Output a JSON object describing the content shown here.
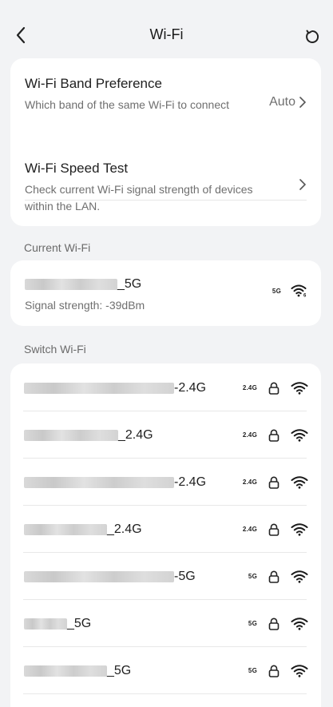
{
  "header": {
    "title": "Wi-Fi"
  },
  "band_preference": {
    "title": "Wi-Fi Band Preference",
    "description": "Which band of the same Wi-Fi to connect",
    "value": "Auto"
  },
  "speed_test": {
    "title": "Wi-Fi Speed Test",
    "description": "Check current Wi-Fi signal strength of devices within the LAN."
  },
  "current_wifi": {
    "section_label": "Current Wi-Fi",
    "name_suffix": "_5G",
    "signal": "Signal strength: -39dBm",
    "band": "5G"
  },
  "switch_wifi": {
    "section_label": "Switch Wi-Fi",
    "networks": [
      {
        "name_suffix": "-2.4G",
        "band": "2.4G"
      },
      {
        "name_suffix": "_2.4G",
        "band": "2.4G"
      },
      {
        "name_suffix": "-2.4G",
        "band": "2.4G"
      },
      {
        "name_suffix": "_2.4G",
        "band": "2.4G"
      },
      {
        "name_suffix": "-5G",
        "band": "5G"
      },
      {
        "name_suffix": "_5G",
        "band": "5G"
      },
      {
        "name_suffix": "_5G",
        "band": "5G"
      }
    ]
  }
}
